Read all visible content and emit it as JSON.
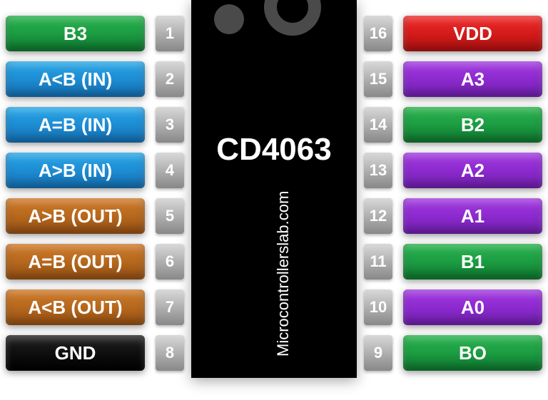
{
  "chip": {
    "name": "CD4063",
    "watermark": "Microcontrollerslab.com"
  },
  "left_pins": [
    {
      "num": "1",
      "label": "B3",
      "color": "c-green"
    },
    {
      "num": "2",
      "label": "A<B (IN)",
      "color": "c-blue"
    },
    {
      "num": "3",
      "label": "A=B (IN)",
      "color": "c-blue"
    },
    {
      "num": "4",
      "label": "A>B (IN)",
      "color": "c-blue"
    },
    {
      "num": "5",
      "label": "A>B (OUT)",
      "color": "c-orange"
    },
    {
      "num": "6",
      "label": "A=B (OUT)",
      "color": "c-orange"
    },
    {
      "num": "7",
      "label": "A<B (OUT)",
      "color": "c-orange"
    },
    {
      "num": "8",
      "label": "GND",
      "color": "c-black"
    }
  ],
  "right_pins": [
    {
      "num": "16",
      "label": "VDD",
      "color": "c-red"
    },
    {
      "num": "15",
      "label": "A3",
      "color": "c-purple"
    },
    {
      "num": "14",
      "label": "B2",
      "color": "c-green"
    },
    {
      "num": "13",
      "label": "A2",
      "color": "c-purple"
    },
    {
      "num": "12",
      "label": "A1",
      "color": "c-purple"
    },
    {
      "num": "11",
      "label": "B1",
      "color": "c-green"
    },
    {
      "num": "10",
      "label": "A0",
      "color": "c-purple"
    },
    {
      "num": "9",
      "label": "BO",
      "color": "c-green"
    }
  ]
}
